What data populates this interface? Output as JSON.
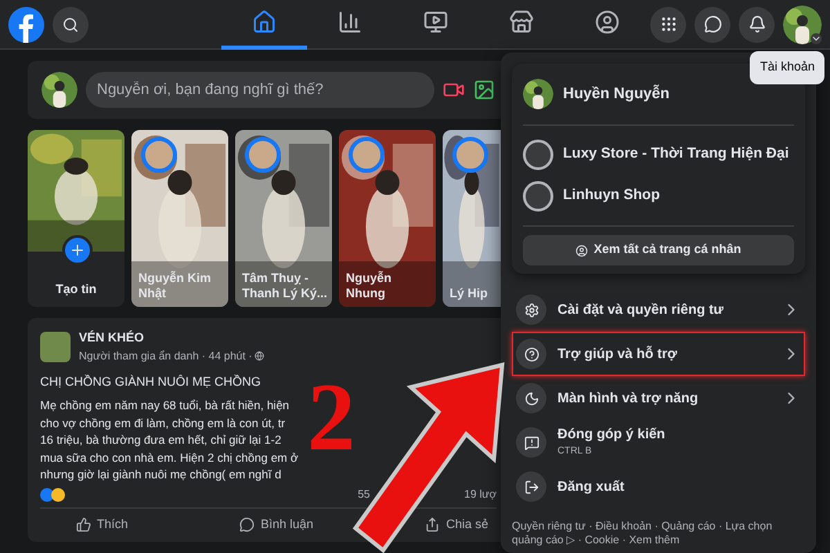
{
  "topbar": {
    "nav_tabs": [
      {
        "kind": "home",
        "selected": true
      },
      {
        "kind": "chart",
        "selected": false
      },
      {
        "kind": "video",
        "selected": false
      },
      {
        "kind": "store",
        "selected": false
      },
      {
        "kind": "groups",
        "selected": false
      }
    ],
    "actions": [
      {
        "kind": "menu"
      },
      {
        "kind": "messenger"
      },
      {
        "kind": "bell"
      }
    ],
    "tooltip": "Tài khoản"
  },
  "composer": {
    "placeholder": "Nguyễn ơi, bạn đang nghĩ gì thế?"
  },
  "stories": [
    {
      "kind": "create",
      "name": "Tạo tin"
    },
    {
      "kind": "story",
      "name": "Nguyễn Kim Nhật"
    },
    {
      "kind": "story",
      "name": "Tâm Thuỵ - Thanh Lý Ký..."
    },
    {
      "kind": "story",
      "name": "Nguyễn Nhung"
    },
    {
      "kind": "story",
      "name": "Lý Hip"
    }
  ],
  "post": {
    "group": "VÉN KHÉO",
    "meta": "Người tham gia ẩn danh · 44 phút ·",
    "title": "CHỊ CHỒNG GIÀNH NUÔI MẸ CHỒNG",
    "lines": [
      "Mẹ chồng em năm nay 68 tuổi, bà rất hiền, hiện",
      "cho vợ chồng em đi làm, chồng em là con út, tr",
      "16 triệu, bà thường đưa em hết, chỉ giữ lại 1-2",
      "mua sữa cho con nhà em. Hiện 2 chị chồng em ở",
      "nhưng giờ lại giành nuôi mẹ chồng( em nghĩ d"
    ],
    "comment_count": "55",
    "share_count": "19 lượ",
    "actions": [
      {
        "kind": "like",
        "label": "Thích"
      },
      {
        "kind": "comment",
        "label": "Bình luận"
      },
      {
        "kind": "share",
        "label": "Chia sẻ"
      }
    ]
  },
  "account_menu": {
    "profile": "Huyền Nguyễn",
    "pages": [
      "Luxy Store - Thời Trang Hiện Đại",
      "Linhuyn Shop"
    ],
    "see_all": "Xem tất cả trang cá nhân",
    "items": [
      {
        "kind": "settings",
        "label": "Cài đặt và quyền riêng tư",
        "submenu": true,
        "highlighted": false
      },
      {
        "kind": "help",
        "label": "Trợ giúp và hỗ trợ",
        "submenu": true,
        "highlighted": true
      },
      {
        "kind": "display",
        "label": "Màn hình và trợ năng",
        "submenu": true,
        "highlighted": false
      },
      {
        "kind": "feedback",
        "label": "Đóng góp ý kiến",
        "shortcut": "CTRL B",
        "submenu": false,
        "highlighted": false
      },
      {
        "kind": "logout",
        "label": "Đăng xuất",
        "submenu": false,
        "highlighted": false
      }
    ],
    "footer": "Quyền riêng tư · Điều khoản · Quảng cáo · Lựa chọn quảng cáo ▷ · Cookie · Xem thêm"
  },
  "annotation": {
    "step": "2"
  }
}
